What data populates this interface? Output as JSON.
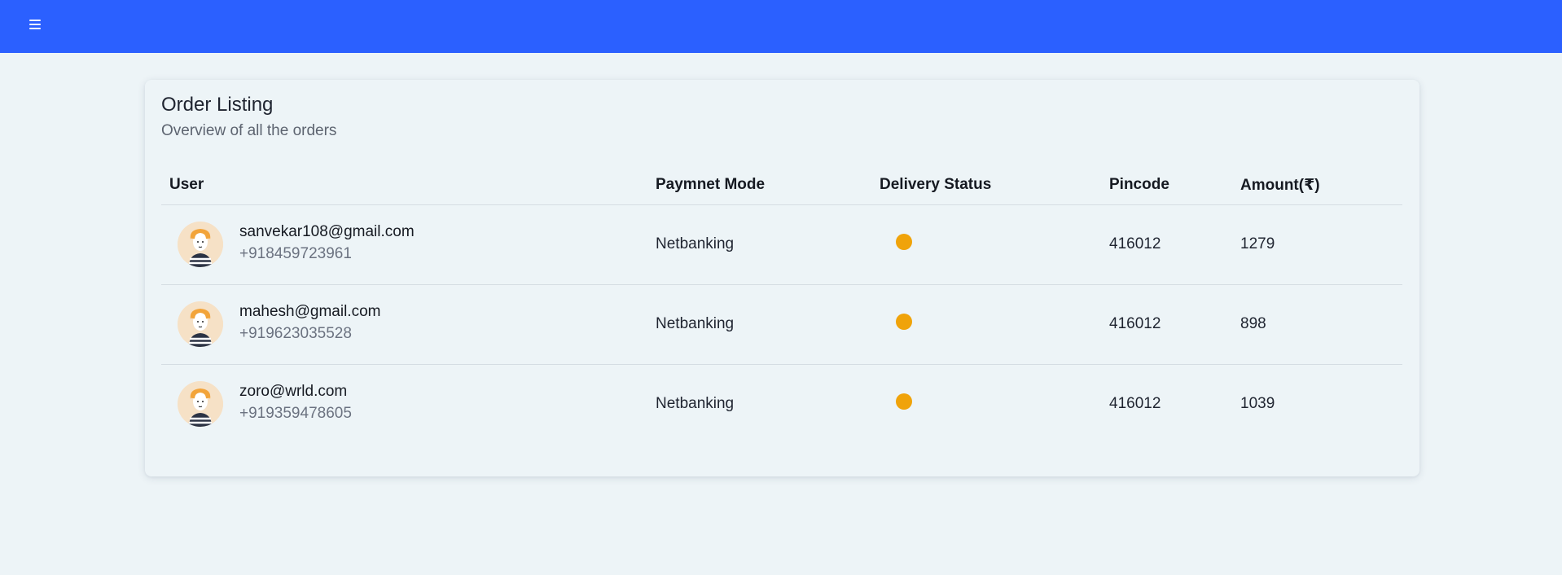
{
  "header": {
    "menu_icon": "hamburger-menu-icon",
    "color": "#2b60ff"
  },
  "card": {
    "title": "Order Listing",
    "subtitle": "Overview of all the orders"
  },
  "table": {
    "columns": [
      "User",
      "Paymnet Mode",
      "Delivery Status",
      "Pincode",
      "Amount(₹)"
    ],
    "rows": [
      {
        "email": "sanvekar108@gmail.com",
        "phone": "+918459723961",
        "payment_mode": "Netbanking",
        "delivery_status_color": "#f0a30a",
        "pincode": "416012",
        "amount": "1279"
      },
      {
        "email": "mahesh@gmail.com",
        "phone": "+919623035528",
        "payment_mode": "Netbanking",
        "delivery_status_color": "#f0a30a",
        "pincode": "416012",
        "amount": "898"
      },
      {
        "email": "zoro@wrld.com",
        "phone": "+919359478605",
        "payment_mode": "Netbanking",
        "delivery_status_color": "#f0a30a",
        "pincode": "416012",
        "amount": "1039"
      }
    ]
  }
}
